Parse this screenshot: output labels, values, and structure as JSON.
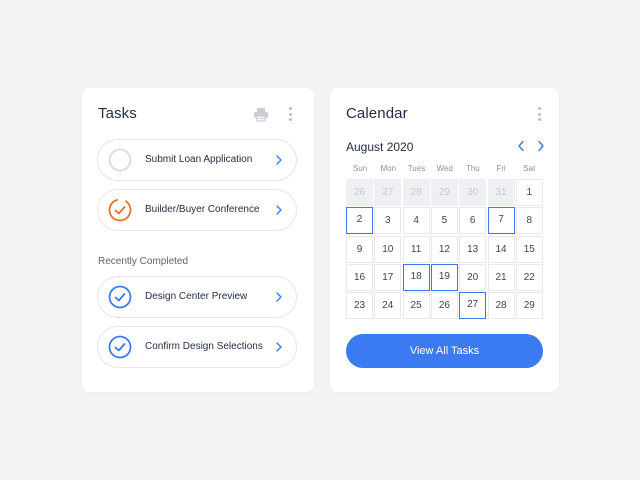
{
  "tasks_card": {
    "title": "Tasks",
    "print_icon": "printer-icon",
    "menu_icon": "kebab-menu-icon",
    "items": [
      {
        "label": "Submit Loan Application",
        "status": "not-started"
      },
      {
        "label": "Builder/Buyer Conference",
        "status": "in-progress"
      }
    ],
    "completed_label": "Recently Completed",
    "completed": [
      {
        "label": "Design Center Preview",
        "status": "done"
      },
      {
        "label": "Confirm Design Selections",
        "status": "done"
      }
    ]
  },
  "calendar_card": {
    "title": "Calendar",
    "menu_icon": "kebab-menu-icon",
    "month_label": "August 2020",
    "prev_icon": "chevron-left-icon",
    "next_icon": "chevron-right-icon",
    "weekdays": [
      "Sun",
      "Mon",
      "Tues",
      "Wed",
      "Thu",
      "Fri",
      "Sat"
    ],
    "prev_month_days": [
      "26",
      "27",
      "28",
      "29",
      "30",
      "31"
    ],
    "days": [
      "1",
      "2",
      "3",
      "4",
      "5",
      "6",
      "7",
      "8",
      "9",
      "10",
      "11",
      "12",
      "13",
      "14",
      "15",
      "16",
      "17",
      "18",
      "19",
      "20",
      "21",
      "22",
      "23",
      "24",
      "25",
      "26",
      "27",
      "28",
      "29"
    ],
    "marked_days": [
      "2",
      "7",
      "18",
      "19",
      "27"
    ],
    "button_label": "View All Tasks"
  },
  "colors": {
    "accent": "#3a7bf2",
    "progress": "#e8712c",
    "background": "#f3f3f4"
  }
}
